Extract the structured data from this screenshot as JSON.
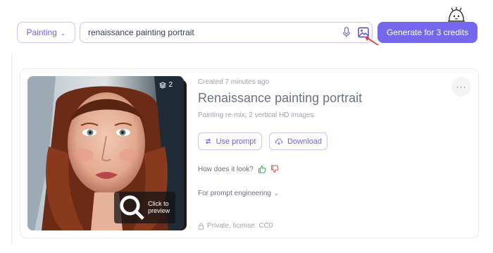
{
  "toolbar": {
    "style_select": {
      "value": "Painting"
    },
    "search": {
      "value": "renaissance painting portrait",
      "icons": [
        "microphone-icon",
        "image-upload-icon"
      ]
    },
    "generate_label": "Generate for 3 credits"
  },
  "result": {
    "created": "Created 7 minutes ago",
    "title": "Renaissance painting portrait",
    "subtitle": "Painting re-mix, 2 vertical HD images",
    "image_count": "2",
    "preview_label": "Click to preview",
    "more_label": "···",
    "use_prompt_label": "Use prompt",
    "download_label": "Download",
    "feedback_question": "How does it look?",
    "prompt_engineering_label": "For prompt engineering",
    "license": "Private, license: CC0"
  },
  "colors": {
    "accent": "#7469ec",
    "accent_text": "#6d63e0",
    "border": "#c9c4f2",
    "thumbs_up": "#34a853",
    "thumbs_down": "#e5484d",
    "arrow": "#e53935"
  }
}
